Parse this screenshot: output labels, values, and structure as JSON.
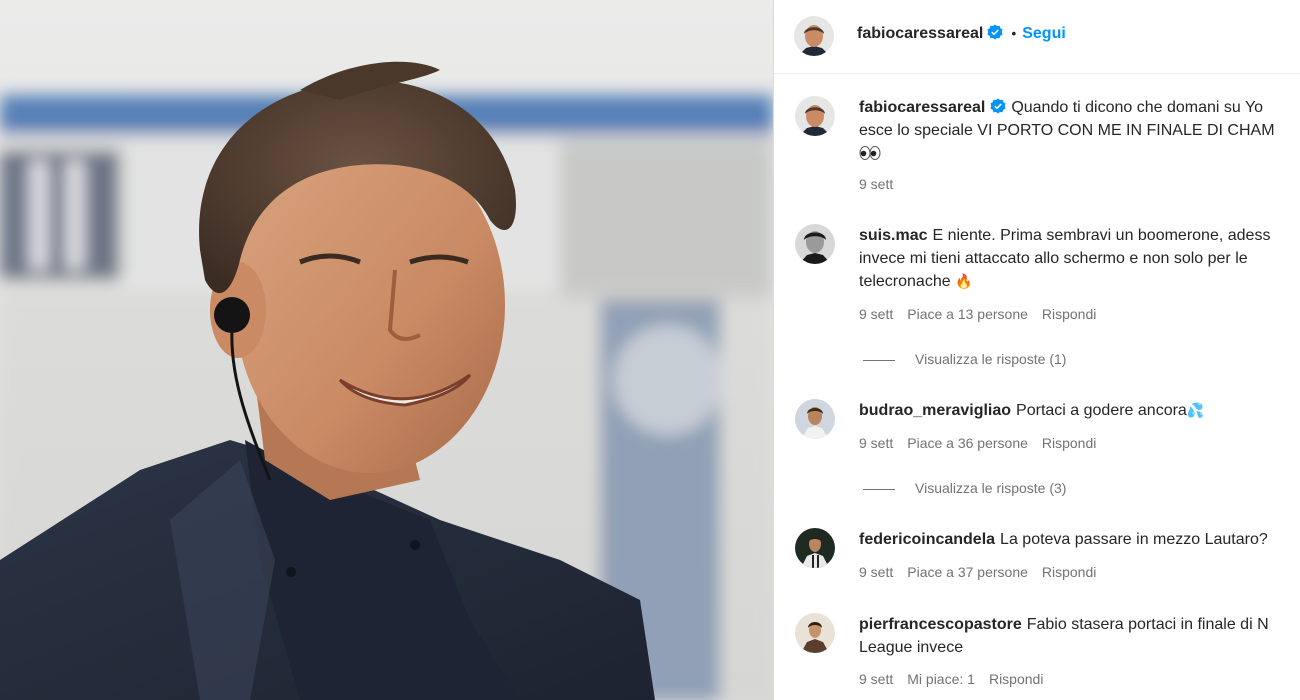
{
  "media": {
    "alt_subject": "smiling man with earpiece in stadium"
  },
  "header": {
    "username": "fabiocaressareal",
    "verified": true,
    "separator": "•",
    "follow_label": "Segui"
  },
  "caption": {
    "username": "fabiocaressareal",
    "verified": true,
    "text_line1": "Quando ti dicono che domani su Yo",
    "text_line2": "esce lo speciale VI PORTO CON ME IN FINALE DI CHAM",
    "emoji": "eyes-icon",
    "time": "9 sett"
  },
  "comments": [
    {
      "username": "suis.mac",
      "text_line1": "E niente. Prima sembravi un boomerone, adess",
      "text_line2": "invece mi tieni attaccato allo schermo e non solo per le",
      "text_line3": "telecronache",
      "emoji": "🔥",
      "time": "9 sett",
      "likes": "Piace a 13 persone",
      "reply": "Rispondi",
      "view_replies": "Visualizza le risposte (1)"
    },
    {
      "username": "budrao_meravigliao",
      "text_line1": "Portaci a godere ancora",
      "emoji": "💦",
      "time": "9 sett",
      "likes": "Piace a 36 persone",
      "reply": "Rispondi",
      "view_replies": "Visualizza le risposte (3)"
    },
    {
      "username": "federicoincandela",
      "text_line1": "La poteva passare in mezzo Lautaro?",
      "time": "9 sett",
      "likes": "Piace a 37 persone",
      "reply": "Rispondi"
    },
    {
      "username": "pierfrancescopastore",
      "text_line1": "Fabio stasera portaci in finale di N",
      "text_line2": "League invece",
      "time": "9 sett",
      "likes": "Mi piace: 1",
      "reply": "Rispondi"
    }
  ],
  "colors": {
    "link_blue": "#0095f6",
    "verified_blue": "#0095f6",
    "meta_gray": "#737373",
    "text": "#262626"
  }
}
